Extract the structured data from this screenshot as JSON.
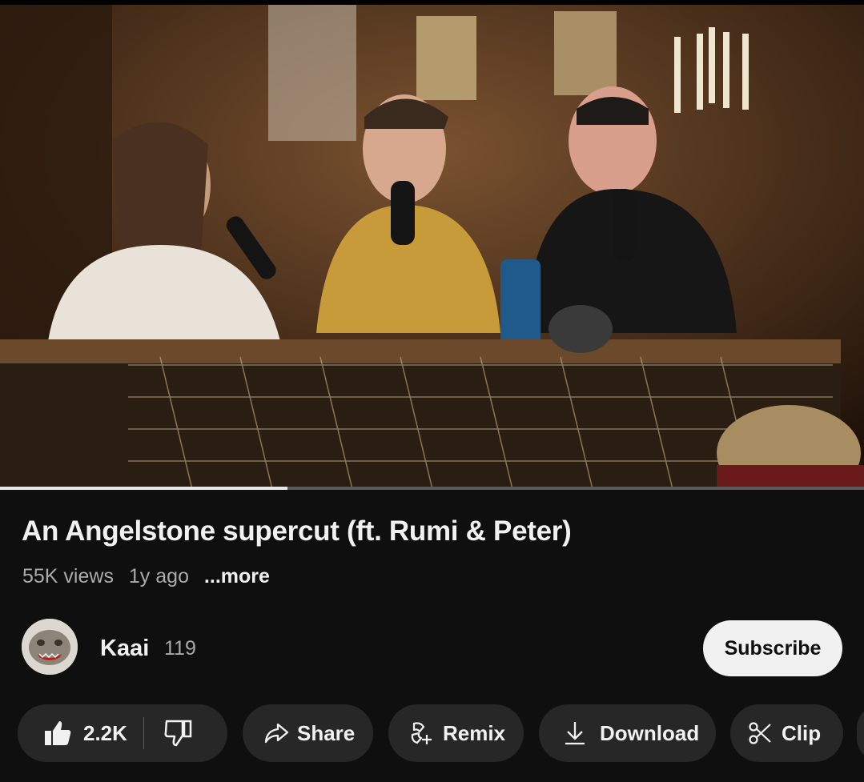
{
  "video": {
    "progress_fraction": 0.333
  },
  "details": {
    "title": "An Angelstone supercut (ft. Rumi & Peter)",
    "views": "55K views",
    "age": "1y ago",
    "more": "...more"
  },
  "channel": {
    "name": "Kaai",
    "subscribers": "119",
    "subscribe_label": "Subscribe"
  },
  "actions": {
    "likes": "2.2K",
    "share_label": "Share",
    "remix_label": "Remix",
    "download_label": "Download",
    "clip_label": "Clip"
  },
  "icons": [
    "thumbs-up-icon",
    "thumbs-down-icon",
    "share-icon",
    "remix-icon",
    "download-icon",
    "scissors-icon"
  ],
  "colors": {
    "background": "#0f0f0f",
    "pill": "#272727",
    "subscribe_bg": "#f1f1f1",
    "secondary_text": "#aaaaaa"
  }
}
